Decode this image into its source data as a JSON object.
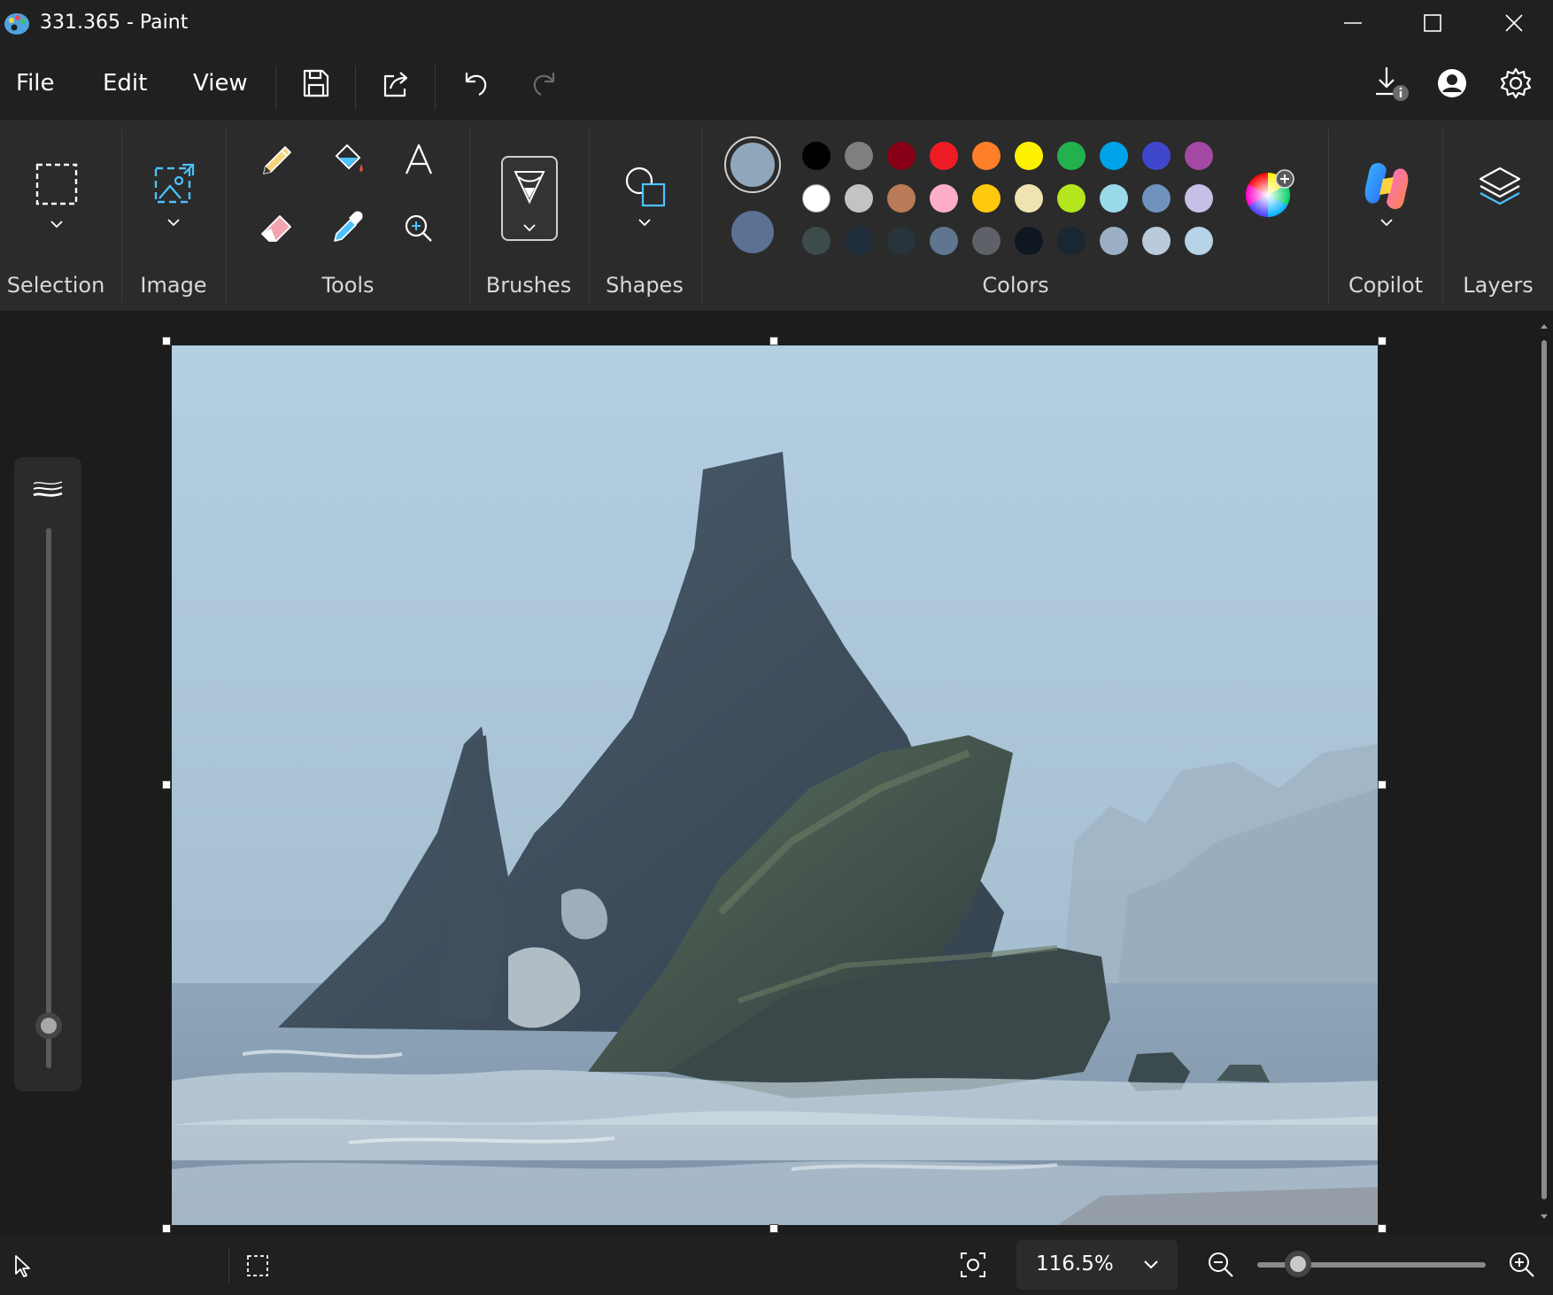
{
  "window": {
    "title": "331.365 - Paint",
    "app_icon": "paint-palette-icon",
    "controls": [
      "minimize-icon",
      "maximize-icon",
      "close-icon"
    ]
  },
  "menu": {
    "items": [
      {
        "label": "File"
      },
      {
        "label": "Edit"
      },
      {
        "label": "View"
      }
    ],
    "quick_actions": [
      "save-icon",
      "share-icon",
      "undo-icon",
      "redo-icon"
    ],
    "right_icons": [
      "download-info-icon",
      "account-icon",
      "settings-icon"
    ]
  },
  "ribbon": {
    "groups": {
      "selection": "Selection",
      "image": "Image",
      "tools": "Tools",
      "brushes": "Brushes",
      "shapes": "Shapes",
      "colors": "Colors",
      "copilot": "Copilot",
      "layers": "Layers"
    },
    "tools": [
      "pencil-icon",
      "fill-icon",
      "text-icon",
      "eraser-icon",
      "color-picker-icon",
      "magnifier-icon"
    ],
    "primary_color": "#8fa6bb",
    "secondary_color": "#5c7194",
    "palette": [
      [
        "#000000",
        "#7f7f7f",
        "#880015",
        "#ed1c24",
        "#ff7f27",
        "#fff200",
        "#22b14c",
        "#00a2e8",
        "#3f48cc",
        "#a349a4"
      ],
      [
        "#ffffff",
        "#c3c3c3",
        "#b97a57",
        "#ffaec9",
        "#ffc90e",
        "#efe4b0",
        "#b5e61d",
        "#99d9ea",
        "#7092be",
        "#c8bfe7"
      ],
      [
        "#3d4b4d",
        "#1f2d3a",
        "#27343c",
        "#5f7590",
        "#5e6168",
        "#0e1722",
        "#1a2630",
        "#9aafc4",
        "#b9cbdb",
        "#b6d3e8"
      ]
    ]
  },
  "canvas": {
    "description_icon": "landscape-painting"
  },
  "brush_size": {
    "level": 0.05,
    "icon": "brush-size-icon"
  },
  "status": {
    "zoom": "116.5%",
    "zoom_fraction": 0.18,
    "icons": [
      "pointer-icon",
      "selection-size-icon",
      "fit-screen-icon",
      "zoom-out-icon",
      "zoom-in-icon"
    ]
  }
}
